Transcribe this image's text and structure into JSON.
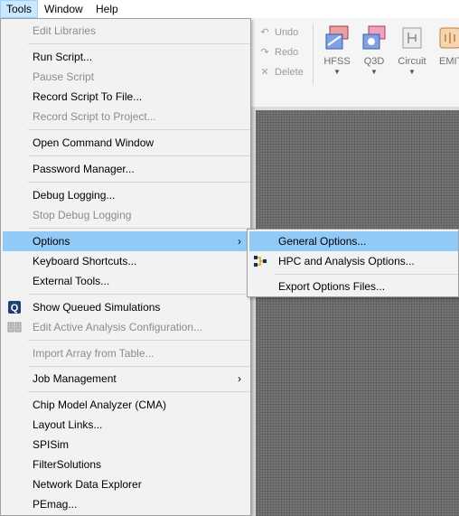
{
  "menubar": {
    "items": [
      {
        "label": "Tools",
        "active": true
      },
      {
        "label": "Window",
        "active": false
      },
      {
        "label": "Help",
        "active": false
      }
    ]
  },
  "toolbar": {
    "undo": "Undo",
    "redo": "Redo",
    "delete": "Delete",
    "tools": [
      {
        "label": "HFSS",
        "icon": "hfss-icon",
        "color": "#5b7fd0"
      },
      {
        "label": "Q3D",
        "icon": "q3d-icon",
        "color": "#c05050"
      },
      {
        "label": "Circuit",
        "icon": "circuit-icon",
        "color": "#8a8a8a"
      },
      {
        "label": "EMIT",
        "icon": "emit-icon",
        "color": "#c87a30"
      }
    ]
  },
  "tools_menu": {
    "items": [
      {
        "label": "Edit Libraries",
        "disabled": true
      },
      {
        "label": "Run Script...",
        "disabled": false
      },
      {
        "label": "Pause Script",
        "disabled": true
      },
      {
        "label": "Record Script To File...",
        "disabled": false
      },
      {
        "label": "Record Script to Project...",
        "disabled": true
      },
      {
        "label": "Open Command Window",
        "disabled": false
      },
      {
        "label": "Password Manager...",
        "disabled": false
      },
      {
        "label": "Debug Logging...",
        "disabled": false
      },
      {
        "label": "Stop Debug Logging",
        "disabled": true
      },
      {
        "label": "Options",
        "disabled": false,
        "submenu": true,
        "highlighted": true
      },
      {
        "label": "Keyboard Shortcuts...",
        "disabled": false
      },
      {
        "label": "External Tools...",
        "disabled": false
      },
      {
        "label": "Show Queued Simulations",
        "disabled": false,
        "icon": "queue-icon"
      },
      {
        "label": "Edit Active Analysis Configuration...",
        "disabled": true,
        "icon": "analysis-config-icon"
      },
      {
        "label": "Import Array from Table...",
        "disabled": true
      },
      {
        "label": "Job Management",
        "disabled": false,
        "submenu": true
      },
      {
        "label": "Chip Model Analyzer (CMA)",
        "disabled": false
      },
      {
        "label": "Layout Links...",
        "disabled": false
      },
      {
        "label": "SPISim",
        "disabled": false
      },
      {
        "label": "FilterSolutions",
        "disabled": false
      },
      {
        "label": "Network Data Explorer",
        "disabled": false
      },
      {
        "label": "PEmag...",
        "disabled": false
      }
    ],
    "submenu_arrow": "›"
  },
  "options_submenu": {
    "items": [
      {
        "label": "General Options...",
        "highlighted": true
      },
      {
        "label": "HPC and Analysis Options...",
        "icon": "hpc-icon"
      },
      {
        "label": "Export Options Files..."
      }
    ]
  },
  "colors": {
    "highlight": "#91c9f7",
    "menubar_active": "#cce8ff",
    "disabled_text": "#8c8c8c"
  }
}
